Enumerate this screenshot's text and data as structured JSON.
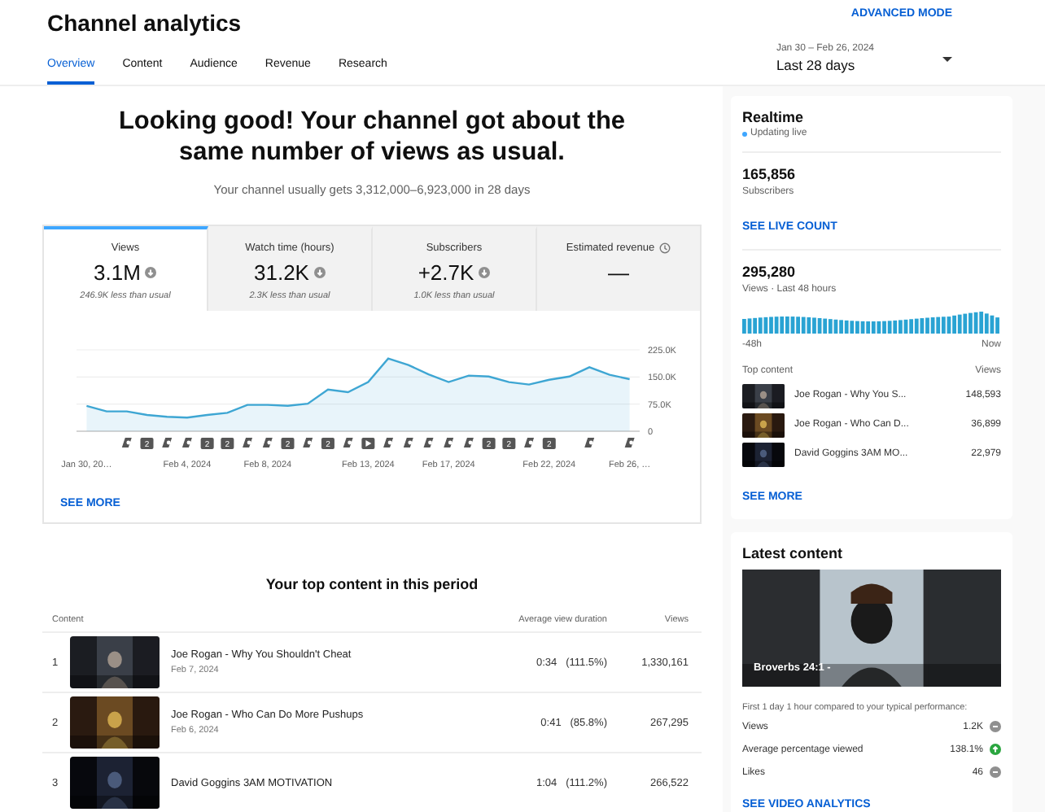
{
  "header": {
    "title": "Channel analytics",
    "advanced_mode": "ADVANCED MODE",
    "date_range": "Jan 30 – Feb 26, 2024",
    "period": "Last 28 days"
  },
  "tabs": [
    {
      "label": "Overview",
      "selected": true
    },
    {
      "label": "Content",
      "selected": false
    },
    {
      "label": "Audience",
      "selected": false
    },
    {
      "label": "Revenue",
      "selected": false
    },
    {
      "label": "Research",
      "selected": false
    }
  ],
  "summary": {
    "headline": "Looking good! Your channel got about the same number of views as usual.",
    "subtext": "Your channel usually gets 3,312,000–6,923,000 in 28 days"
  },
  "metrics": [
    {
      "kind": "stat",
      "label": "Views",
      "value": "3.1M",
      "note": "246.9K less than usual",
      "selected": true
    },
    {
      "kind": "stat",
      "label": "Watch time (hours)",
      "value": "31.2K",
      "note": "2.3K less than usual",
      "selected": false
    },
    {
      "kind": "stat",
      "label": "Subscribers",
      "value": "+2.7K",
      "note": "1.0K less than usual",
      "selected": false
    },
    {
      "kind": "pending",
      "label": "Estimated revenue",
      "value": "—",
      "selected": false
    }
  ],
  "chart": {
    "chart_data": {
      "type": "area",
      "categories": [
        "Jan 30, 20…",
        null,
        null,
        null,
        null,
        "Feb 4, 2024",
        null,
        null,
        null,
        "Feb 8, 2024",
        null,
        null,
        null,
        null,
        "Feb 13, 2024",
        null,
        null,
        null,
        "Feb 17, 2024",
        null,
        null,
        null,
        null,
        "Feb 22, 2024",
        null,
        null,
        null,
        "Feb 26, …"
      ],
      "series": [
        {
          "color": "#3ea6d3",
          "values": [
            70000,
            55000,
            55000,
            45000,
            40000,
            38000,
            45000,
            51000,
            73000,
            73000,
            70000,
            76000,
            115000,
            108000,
            136000,
            201000,
            183000,
            157000,
            136000,
            154000,
            151000,
            136000,
            129000,
            142000,
            151000,
            177000,
            156000,
            144000
          ]
        }
      ],
      "ylim": [
        0,
        225000
      ],
      "yticks": [
        {
          "value": 0,
          "label": "0"
        },
        {
          "value": 75000,
          "label": "75.0K"
        },
        {
          "value": 150000,
          "label": "150.0K"
        },
        {
          "value": 225000,
          "label": "225.0K"
        }
      ]
    },
    "markers": [
      {
        "kind": "none"
      },
      {
        "kind": "none"
      },
      {
        "kind": "short"
      },
      {
        "kind": "count",
        "text": "2"
      },
      {
        "kind": "short"
      },
      {
        "kind": "short"
      },
      {
        "kind": "count",
        "text": "2"
      },
      {
        "kind": "count",
        "text": "2"
      },
      {
        "kind": "short"
      },
      {
        "kind": "short"
      },
      {
        "kind": "count",
        "text": "2"
      },
      {
        "kind": "short"
      },
      {
        "kind": "count",
        "text": "2"
      },
      {
        "kind": "short"
      },
      {
        "kind": "video"
      },
      {
        "kind": "short"
      },
      {
        "kind": "short"
      },
      {
        "kind": "short"
      },
      {
        "kind": "short"
      },
      {
        "kind": "short"
      },
      {
        "kind": "count",
        "text": "2"
      },
      {
        "kind": "count",
        "text": "2"
      },
      {
        "kind": "short"
      },
      {
        "kind": "count",
        "text": "2"
      },
      {
        "kind": "none"
      },
      {
        "kind": "short"
      },
      {
        "kind": "none"
      },
      {
        "kind": "short"
      }
    ],
    "see_more": "SEE MORE"
  },
  "top_content": {
    "title": "Your top content in this period",
    "columns": [
      "Content",
      "Average view duration",
      "Views"
    ],
    "rows": [
      {
        "rank": "1",
        "title": "Joe Rogan - Why You Shouldn't Cheat",
        "date": "Feb 7, 2024",
        "duration": "0:34",
        "percent": "(111.5%)",
        "views": "1,330,161"
      },
      {
        "rank": "2",
        "title": "Joe Rogan - Who Can Do More Pushups",
        "date": "Feb 6, 2024",
        "duration": "0:41",
        "percent": "(85.8%)",
        "views": "267,295"
      },
      {
        "rank": "3",
        "title": "David Goggins 3AM MOTIVATION",
        "duration": "1:04",
        "percent": "(111.2%)",
        "views": "266,522"
      }
    ]
  },
  "realtime": {
    "title": "Realtime",
    "status": "Updating live",
    "subscribers": "165,856",
    "subscribers_label": "Subscribers",
    "live_count": "SEE LIVE COUNT",
    "views": "295,280",
    "views_label": "Views · Last 48 hours",
    "axis_start": "-48h",
    "axis_end": "Now",
    "top_label": "Top content",
    "views_col": "Views",
    "items": [
      {
        "title": "Joe Rogan - Why You S...",
        "views": "148,593"
      },
      {
        "title": "Joe Rogan - Who Can D...",
        "views": "36,899"
      },
      {
        "title": "David Goggins 3AM MO...",
        "views": "22,979"
      }
    ],
    "see_more": "SEE MORE"
  },
  "latest": {
    "title": "Latest content",
    "video_title": "Broverbs 24:1 -",
    "caption": "First 1 day 1 hour compared to your typical performance:",
    "stats": [
      {
        "label": "Views",
        "value": "1.2K",
        "kind": "neutral"
      },
      {
        "label": "Average percentage viewed",
        "value": "138.1%",
        "kind": "up"
      },
      {
        "label": "Likes",
        "value": "46",
        "kind": "neutral"
      }
    ],
    "link": "SEE VIDEO ANALYTICS"
  }
}
